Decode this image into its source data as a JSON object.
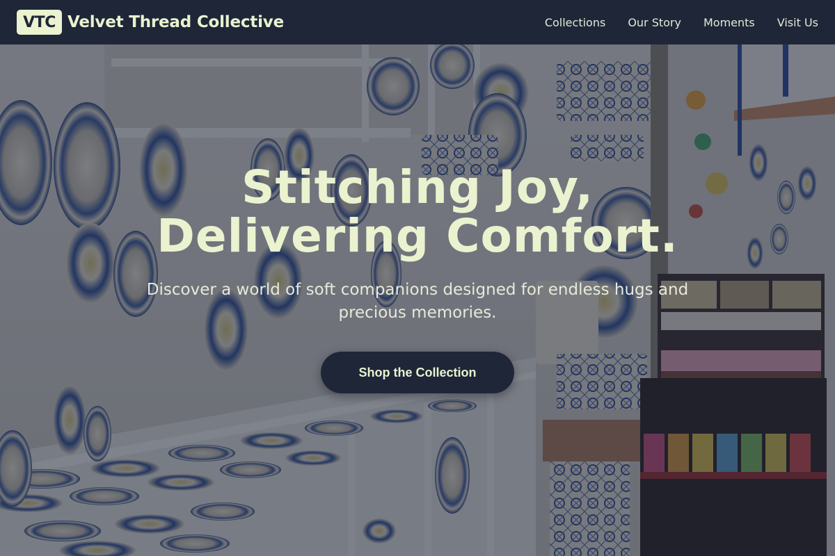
{
  "brand": {
    "badge": "VTC",
    "name": "Velvet Thread Collective"
  },
  "nav": {
    "items": [
      {
        "label": "Collections"
      },
      {
        "label": "Our Story"
      },
      {
        "label": "Moments"
      },
      {
        "label": "Visit Us"
      }
    ]
  },
  "hero": {
    "title_line1": "Stitching Joy,",
    "title_line2": "Delivering Comfort.",
    "subtitle": "Discover a world of soft companions designed for endless hugs and precious memories.",
    "cta_label": "Shop the Collection",
    "background": "photo of a shop with ceramic plates and pottery displayed on shelves"
  },
  "colors": {
    "header_bg": "#1e2638",
    "accent_text": "#eaf2cf",
    "button_bg": "#1e2638"
  }
}
